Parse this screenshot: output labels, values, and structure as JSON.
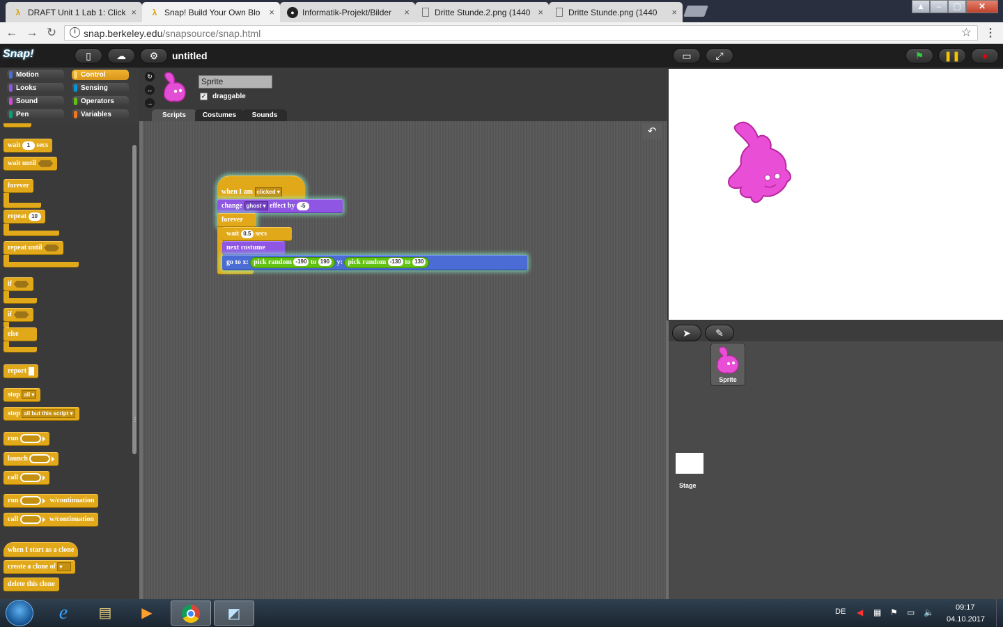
{
  "browser": {
    "tabs": [
      {
        "label": "DRAFT Unit 1 Lab 1: Click",
        "icon": "snap-lambda-icon",
        "active": false
      },
      {
        "label": "Snap! Build Your Own Blo",
        "icon": "snap-lambda-icon",
        "active": true
      },
      {
        "label": "Informatik-Projekt/Bilder",
        "icon": "github-icon",
        "active": false
      },
      {
        "label": "Dritte Stunde.2.png (1440",
        "icon": "document-icon",
        "active": false
      },
      {
        "label": "Dritte Stunde.png (1440",
        "icon": "document-icon",
        "active": false
      }
    ],
    "close_glyph": "×",
    "url_host": "snap.berkeley.edu",
    "url_path": "/snapsource/snap.html"
  },
  "snap": {
    "logo": "Snap!",
    "project_title": "untitled"
  },
  "categories": [
    {
      "label": "Motion",
      "color": "#4a6cd4"
    },
    {
      "label": "Control",
      "color": "#e6a822",
      "selected": true
    },
    {
      "label": "Looks",
      "color": "#8f56e3"
    },
    {
      "label": "Sensing",
      "color": "#0494dc"
    },
    {
      "label": "Sound",
      "color": "#cf4ad9"
    },
    {
      "label": "Operators",
      "color": "#62c213"
    },
    {
      "label": "Pen",
      "color": "#00a178"
    },
    {
      "label": "Variables",
      "color": "#f3761d"
    }
  ],
  "palette": {
    "wait_label": "wait",
    "wait_value": "1",
    "wait_unit": "secs",
    "wait_until_label": "wait until",
    "forever_label": "forever",
    "repeat_label": "repeat",
    "repeat_value": "10",
    "repeat_until_label": "repeat until",
    "if_label": "if",
    "if2_label": "if",
    "else_label": "else",
    "report_label": "report",
    "stop_label": "stop",
    "stop_option": "all",
    "stop2_label": "stop",
    "stop2_option": "all but this script",
    "run_label": "run",
    "launch_label": "launch",
    "call_label": "call",
    "runc_label": "run",
    "runc_suffix": "w/continuation",
    "callc_label": "call",
    "callc_suffix": "w/continuation",
    "clone_hat_label": "when I start as a clone",
    "create_clone_label": "create a clone of",
    "delete_clone_label": "delete this clone"
  },
  "sprite": {
    "name": "Sprite",
    "draggable_label": "draggable",
    "draggable_checked": "✓",
    "tabs": [
      "Scripts",
      "Costumes",
      "Sounds"
    ]
  },
  "script": {
    "hat_label": "when I am",
    "hat_option": "clicked",
    "change_label": "change",
    "change_option": "ghost",
    "change_effect_label": "effect by",
    "change_value": "-5",
    "forever_label": "forever",
    "wait_label": "wait",
    "wait_value": "0.5",
    "wait_unit": "secs",
    "next_costume_label": "next costume",
    "goto_label": "go to x:",
    "pick_random_label": "pick random",
    "x_min": "-190",
    "to_label": "to",
    "x_max": "190",
    "y_label": "y:",
    "y_min": "-130",
    "y_max": "130"
  },
  "corral": {
    "sprite_label": "Sprite",
    "stage_label": "Stage"
  },
  "taskbar": {
    "language": "DE",
    "time": "09:17",
    "date": "04.10.2017"
  }
}
